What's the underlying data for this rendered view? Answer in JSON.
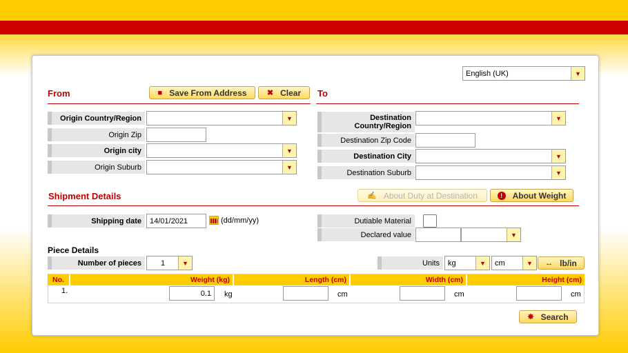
{
  "language": {
    "selected": "English (UK)"
  },
  "from": {
    "title": "From",
    "save_label": "Save From Address",
    "clear_label": "Clear",
    "country_label": "Origin Country/Region",
    "zip_label": "Origin Zip",
    "city_label": "Origin city",
    "suburb_label": "Origin Suburb",
    "country_value": "",
    "zip_value": "",
    "city_value": "",
    "suburb_value": ""
  },
  "to": {
    "title": "To",
    "country_label": "Destination Country/Region",
    "zip_label": "Destination Zip Code",
    "city_label": "Destination City",
    "suburb_label": "Destination Suburb",
    "country_value": "",
    "zip_value": "",
    "city_value": "",
    "suburb_value": ""
  },
  "shipment": {
    "title": "Shipment Details",
    "duty_label": "About Duty at Destination",
    "weight_label": "About Weight",
    "date_label": "Shipping date",
    "date_value": "14/01/2021",
    "date_format": "(dd/mm/yy)",
    "dutiable_label": "Dutiable Material",
    "declared_label": "Declared value",
    "declared_value": "",
    "currency_value": ""
  },
  "pieces": {
    "title": "Piece Details",
    "count_label": "Number of pieces",
    "count_value": "1",
    "units_label": "Units",
    "weight_unit": "kg",
    "length_unit": "cm",
    "toggle_label": "lb/in",
    "columns": [
      "No.",
      "Weight (kg)",
      "Length (cm)",
      "Width (cm)",
      "Height (cm)"
    ],
    "rows": [
      {
        "no": "1.",
        "weight": "0.1",
        "weight_unit": "kg",
        "length": "",
        "length_unit": "cm",
        "width": "",
        "width_unit": "cm",
        "height": "",
        "height_unit": "cm"
      }
    ]
  },
  "search_label": "Search",
  "colors": {
    "brand_yellow": "#ffcc00",
    "brand_red": "#cc0000"
  }
}
